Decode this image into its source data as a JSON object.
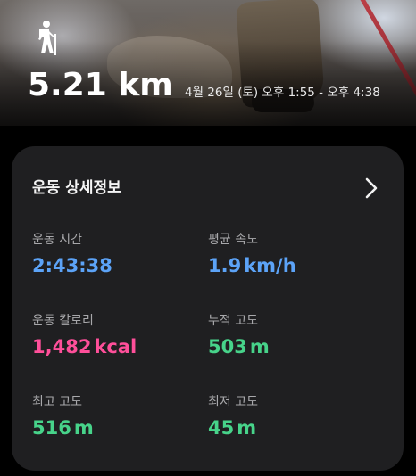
{
  "colors": {
    "duration": "#5ca3f7",
    "speed": "#5ca3f7",
    "calories": "#ff4f9a",
    "elevation": "#47d38a",
    "card_bg": "#1f1f21"
  },
  "header": {
    "activity_icon": "hiking-icon",
    "distance": "5.21 km",
    "time_range": "4월 26일 (토) 오후 1:55 - 오후 4:38"
  },
  "details": {
    "title": "운동 상세정보",
    "open_icon": "chevron-right-icon",
    "metrics": [
      {
        "label": "운동 시간",
        "value": "2:43:38",
        "unit": ""
      },
      {
        "label": "평균 속도",
        "value": "1.9",
        "unit": "km/h"
      },
      {
        "label": "운동 칼로리",
        "value": "1,482",
        "unit": "kcal"
      },
      {
        "label": "누적 고도",
        "value": "503",
        "unit": "m"
      },
      {
        "label": "최고 고도",
        "value": "516",
        "unit": "m"
      },
      {
        "label": "최저 고도",
        "value": "45",
        "unit": "m"
      }
    ]
  }
}
